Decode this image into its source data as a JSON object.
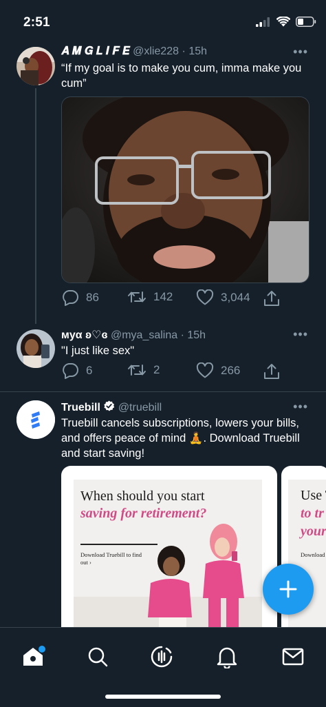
{
  "status_bar": {
    "time": "2:51"
  },
  "tweets": [
    {
      "name": "𝑨 𝑴 𝑮 𝑳 𝑰 𝑭 𝑬",
      "handle": "@xlie228",
      "time": "15h",
      "text": "“If my goal is to make you cum, imma make you cum”",
      "replies": "86",
      "retweets": "142",
      "likes": "3,044"
    },
    {
      "name": "мyα ʚ♡ɞ",
      "handle": "@mya_salina",
      "time": "15h",
      "text": "\"I just like sex\"",
      "replies": "6",
      "retweets": "2",
      "likes": "266"
    },
    {
      "name": "Truebill",
      "handle": "@truebill",
      "text": "Truebill cancels subscriptions, lowers your bills, and offers peace of mind 🧘. Download Truebill and start saving!"
    }
  ],
  "ad_card": {
    "title": "When should you start",
    "title_highlight": "saving for retirement?",
    "cta": "Download Truebill to find out ›",
    "next_title": "Use T",
    "next_highlight": "to tr your",
    "next_cta": "Download"
  },
  "separator": "·",
  "colors": {
    "background": "#15202b",
    "accent": "#1d9bf0",
    "muted": "#8899a6",
    "divider": "#38444d",
    "ad_pink": "#d14a86"
  }
}
